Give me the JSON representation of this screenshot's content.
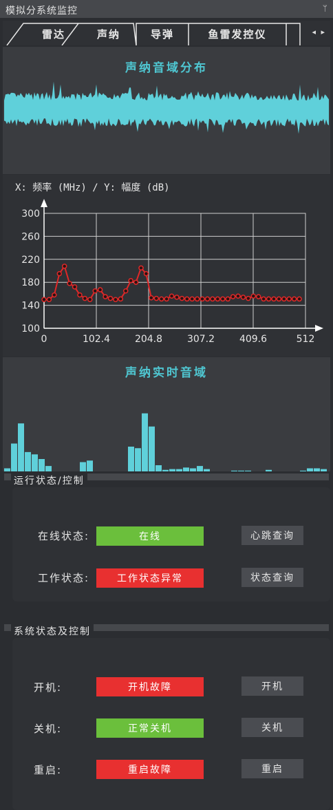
{
  "window": {
    "title": "模拟分系统监控"
  },
  "tabs": [
    {
      "label": "雷达"
    },
    {
      "label": "声纳"
    },
    {
      "label": "导弹"
    },
    {
      "label": "鱼雷发控仪"
    }
  ],
  "sonar": {
    "waveform_title": "声纳音域分布",
    "spectrum_label": "X: 频率 (MHz) / Y: 幅度 (dB)",
    "realtime_title": "声纳实时音域"
  },
  "chart_data": [
    {
      "type": "line",
      "xlabel": "频率 (MHz)",
      "ylabel": "幅度 (dB)",
      "xlim": [
        0,
        512
      ],
      "ylim": [
        100,
        300
      ],
      "x_ticks": [
        "0",
        "102.4",
        "204.8",
        "307.2",
        "409.6",
        "512"
      ],
      "y_ticks": [
        "100",
        "140",
        "180",
        "220",
        "260",
        "300"
      ],
      "grid": true,
      "series": [
        {
          "color": "#e02828",
          "x": [
            0,
            10,
            20,
            30,
            40,
            50,
            60,
            70,
            80,
            90,
            100,
            110,
            120,
            130,
            140,
            150,
            160,
            170,
            180,
            190,
            200,
            210,
            220,
            230,
            240,
            250,
            260,
            270,
            280,
            290,
            300,
            310,
            320,
            330,
            340,
            350,
            360,
            370,
            380,
            390,
            400,
            410,
            420,
            430,
            440,
            450,
            460,
            470,
            480,
            490,
            500
          ],
          "y": [
            150,
            150,
            158,
            195,
            208,
            178,
            172,
            158,
            152,
            150,
            165,
            167,
            155,
            152,
            150,
            151,
            165,
            183,
            180,
            205,
            195,
            153,
            152,
            151,
            151,
            156,
            154,
            152,
            151,
            151,
            151,
            151,
            151,
            151,
            151,
            151,
            151,
            155,
            156,
            154,
            152,
            156,
            155,
            151,
            151,
            151,
            151,
            151,
            151,
            151,
            151
          ]
        }
      ]
    },
    {
      "type": "bar",
      "values": [
        4,
        36,
        62,
        25,
        22,
        16,
        7,
        0,
        0,
        0,
        0,
        12,
        14,
        0,
        0,
        0,
        0,
        0,
        32,
        30,
        75,
        58,
        8,
        2,
        3,
        3,
        5,
        4,
        7,
        3,
        0,
        0,
        0,
        1,
        1,
        1,
        0,
        0,
        2,
        0,
        0,
        0,
        0,
        1,
        4,
        4,
        3
      ]
    }
  ],
  "run_status": {
    "group_title": "运行状态/控制",
    "online_label": "在线状态:",
    "online_value": "在线",
    "heartbeat_button": "心跳查询",
    "work_label": "工作状态:",
    "work_value": "工作状态异常",
    "status_button": "状态查询"
  },
  "system_control": {
    "group_title": "系统状态及控制",
    "power_on_label": "开机:",
    "power_on_value": "开机故障",
    "power_on_button": "开机",
    "power_off_label": "关机:",
    "power_off_value": "正常关机",
    "power_off_button": "关机",
    "restart_label": "重启:",
    "restart_value": "重启故障",
    "restart_button": "重启"
  },
  "colors": {
    "ok": "#6bbf3c",
    "error": "#e83030",
    "cyan": "#5fd0da",
    "accent": "#4fc7d2"
  }
}
